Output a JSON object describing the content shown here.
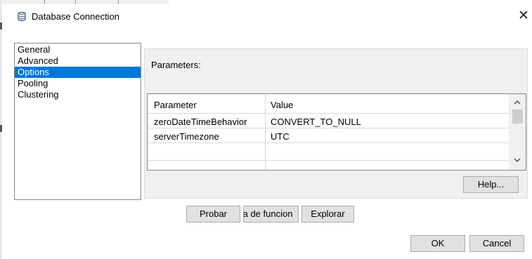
{
  "window": {
    "title": "Database Connection",
    "icon": "database-icon",
    "close_glyph": "✕"
  },
  "categories": [
    "General",
    "Advanced",
    "Options",
    "Pooling",
    "Clustering"
  ],
  "selected_category": "Options",
  "options": {
    "parameters_label": "Parameters:",
    "columns": [
      "Parameter",
      "Value"
    ],
    "rows": [
      {
        "parameter": "zeroDateTimeBehavior",
        "value": "CONVERT_TO_NULL"
      },
      {
        "parameter": "serverTimezone",
        "value": "UTC"
      }
    ],
    "help_label": "Help..."
  },
  "bottom_buttons": {
    "probar": "Probar",
    "funciones": "ta de funcion",
    "explorar": "Explorar"
  },
  "dialog_buttons": {
    "ok": "OK",
    "cancel": "Cancel"
  },
  "colors": {
    "selection": "#0078d7",
    "panel": "#f0f0f0",
    "button": "#e1e1e1"
  }
}
